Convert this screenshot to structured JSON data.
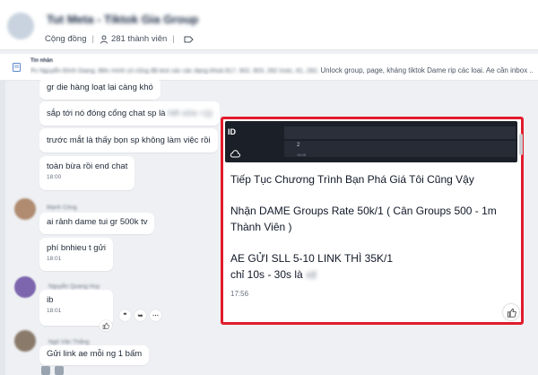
{
  "header": {
    "group_title": "Tut Meta - Tiktok Gia Group",
    "community_label": "Cộng đồng",
    "members": "281 thành viên"
  },
  "pinned": {
    "label": "Tin nhắn",
    "blurred_text": "Pv Nguyễn Đình Giang. Bên mình có cũng đã test các các dạng khoá 817, 902, 903, 282 Instc, 81, 282,",
    "visible_text": "Unlock group, page, kháng tiktok Dame rip các loại. Ae cần inbox ..."
  },
  "messages": [
    {
      "text": "gr die hàng loạt lại càng khó"
    },
    {
      "text": "sắp tới nó đóng cổng chat sp là",
      "blurred": "hết sửa =)))"
    },
    {
      "text": "trước mắt là thấy bọn sp không làm việc rồi"
    },
    {
      "text": "toàn bừa rồi end chat",
      "time": "18:00"
    },
    {
      "sender": "Mạnh Công",
      "text": "ai rảnh dame tui gr 500k tv"
    },
    {
      "text": "phí bnhieu t gửi",
      "time": "18:01"
    },
    {
      "sender": "Nguyễn Quang Huy",
      "text": "ib",
      "time": "18:01"
    },
    {
      "sender": "Ngô Văn Thắng",
      "text": "Gửi link ae mỗi ng 1 bấm"
    }
  ],
  "avatars": {
    "a1": "#b08b70",
    "a2": "#6b4fa3",
    "a3": "#8a7a6a"
  },
  "card": {
    "thumb_label": "ID",
    "thumb_num": "2",
    "thumb_small": "14:05",
    "line1": "Tiếp Tục Chương Trình Bạn Phá Giá Tôi Cũng Vậy",
    "line2": "Nhận DAME Groups Rate 50k/1  ( Cân Groups 500 - 1m",
    "line3": "Thành Viên )",
    "line4": "AE GỬI SLL 5-10 LINK THÌ 35K/1",
    "line5": "chỉ 10s - 30s là",
    "line5_blur": "xịt",
    "time": "17:56",
    "highlight_color": "#e21b2c"
  },
  "icons": [
    "person-icon",
    "tag-icon",
    "pin-icon",
    "cloud-icon",
    "like-icon",
    "reply-icon",
    "forward-icon",
    "more-icon"
  ]
}
